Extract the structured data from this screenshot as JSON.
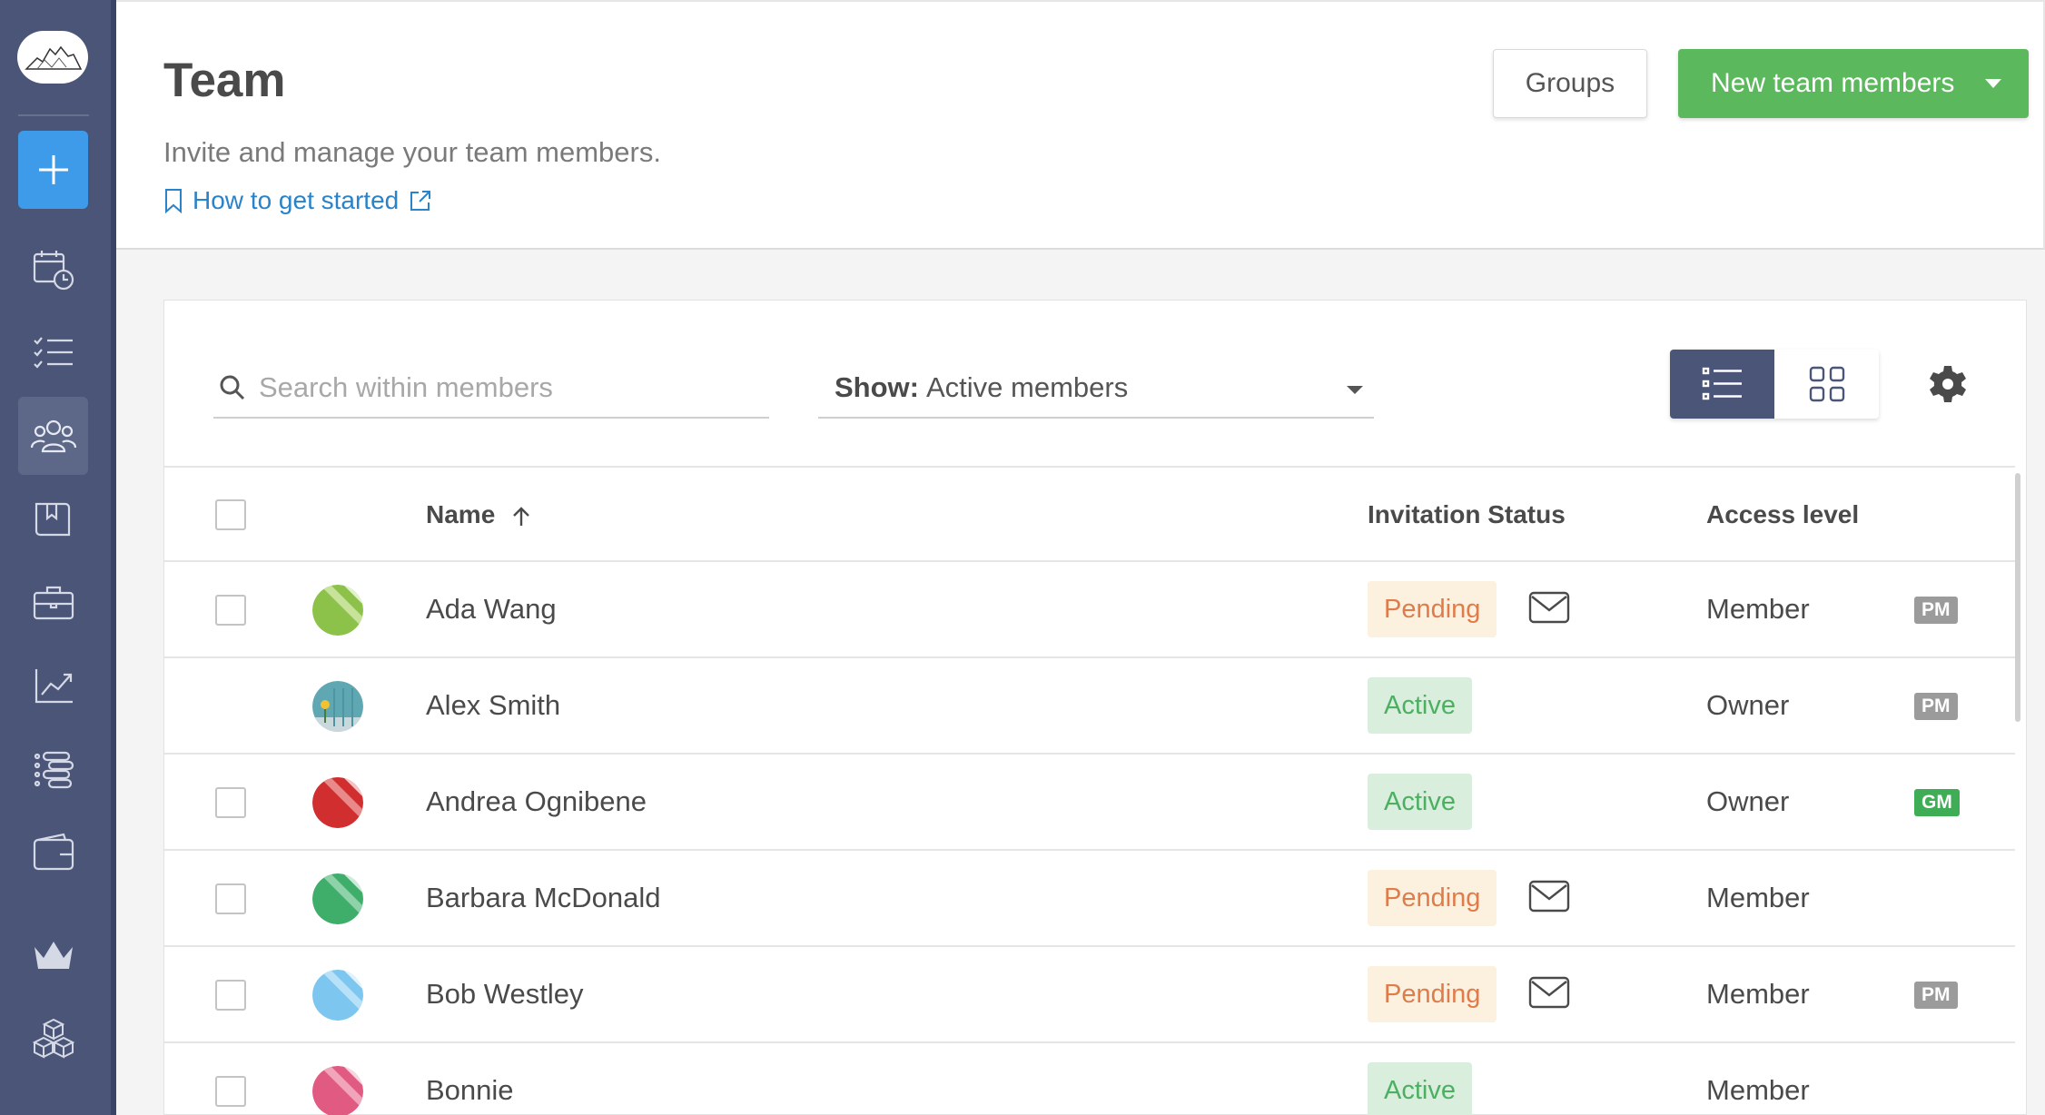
{
  "sidebar": {
    "items": [
      {
        "name": "calendar-clock-icon"
      },
      {
        "name": "tasks-list-icon"
      },
      {
        "name": "team-icon",
        "active": true
      },
      {
        "name": "book-icon"
      },
      {
        "name": "briefcase-icon"
      },
      {
        "name": "chart-icon"
      },
      {
        "name": "timeline-icon"
      },
      {
        "name": "wallet-icon"
      },
      {
        "name": "crown-icon"
      },
      {
        "name": "cubes-icon"
      }
    ]
  },
  "header": {
    "title": "Team",
    "subtitle": "Invite and manage your team members.",
    "help_link": "How to get started",
    "groups_label": "Groups",
    "new_members_label": "New team members"
  },
  "toolbar": {
    "search_placeholder": "Search within members",
    "show_prefix": "Show:",
    "show_value": "Active members"
  },
  "table": {
    "columns": {
      "name": "Name",
      "status": "Invitation Status",
      "access": "Access level"
    },
    "rows": [
      {
        "name": "Ada Wang",
        "status": "Pending",
        "access": "Member",
        "role": "PM",
        "avatar_color": "#8dc24a",
        "has_checkbox": true
      },
      {
        "name": "Alex Smith",
        "status": "Active",
        "access": "Owner",
        "role": "PM",
        "avatar_color": "#5fa8b3",
        "has_checkbox": false
      },
      {
        "name": "Andrea Ognibene",
        "status": "Active",
        "access": "Owner",
        "role": "GM",
        "avatar_color": "#d12f2f",
        "has_checkbox": true
      },
      {
        "name": "Barbara McDonald",
        "status": "Pending",
        "access": "Member",
        "role": "",
        "avatar_color": "#3fae6a",
        "has_checkbox": true
      },
      {
        "name": "Bob Westley",
        "status": "Pending",
        "access": "Member",
        "role": "PM",
        "avatar_color": "#7cc6f0",
        "has_checkbox": true
      },
      {
        "name": "Bonnie",
        "status": "Active",
        "access": "Member",
        "role": "",
        "avatar_color": "#e05a82",
        "has_checkbox": true
      }
    ]
  },
  "colors": {
    "sidebar": "#4a5578",
    "accent_blue": "#3d9be9",
    "green": "#5cb85c",
    "pending_text": "#e07b4a",
    "active_text": "#4caf62"
  }
}
